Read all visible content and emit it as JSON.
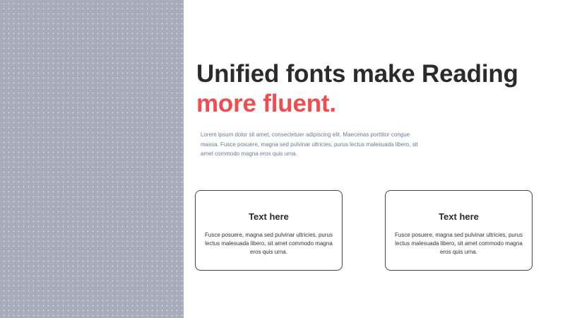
{
  "headline": {
    "line1": "Unified fonts make Reading",
    "line2": "more fluent."
  },
  "intro": "Lorem ipsum dolor sit amet, consectetuer adipiscing elit. Maecenas porttitor congue massa. Fusce posuere, magna sed pulvinar ultricies, purus lectus malesuada libero, sit amet commodo magna eros quis urna.",
  "cards": [
    {
      "title": "Text here",
      "body": "Fusce posuere, magna sed pulvinar ultricies, purus lectus malesuada libero, sit amet commodo magna eros quis urna."
    },
    {
      "title": "Text here",
      "body": "Fusce posuere, magna sed pulvinar ultricies, purus lectus malesuada libero, sit amet commodo magna eros quis urna."
    }
  ],
  "colors": {
    "accent": "#ef4d50",
    "heading": "#2b2b2b",
    "intro_text": "#6c7a95",
    "panel": "#a8adbb"
  }
}
